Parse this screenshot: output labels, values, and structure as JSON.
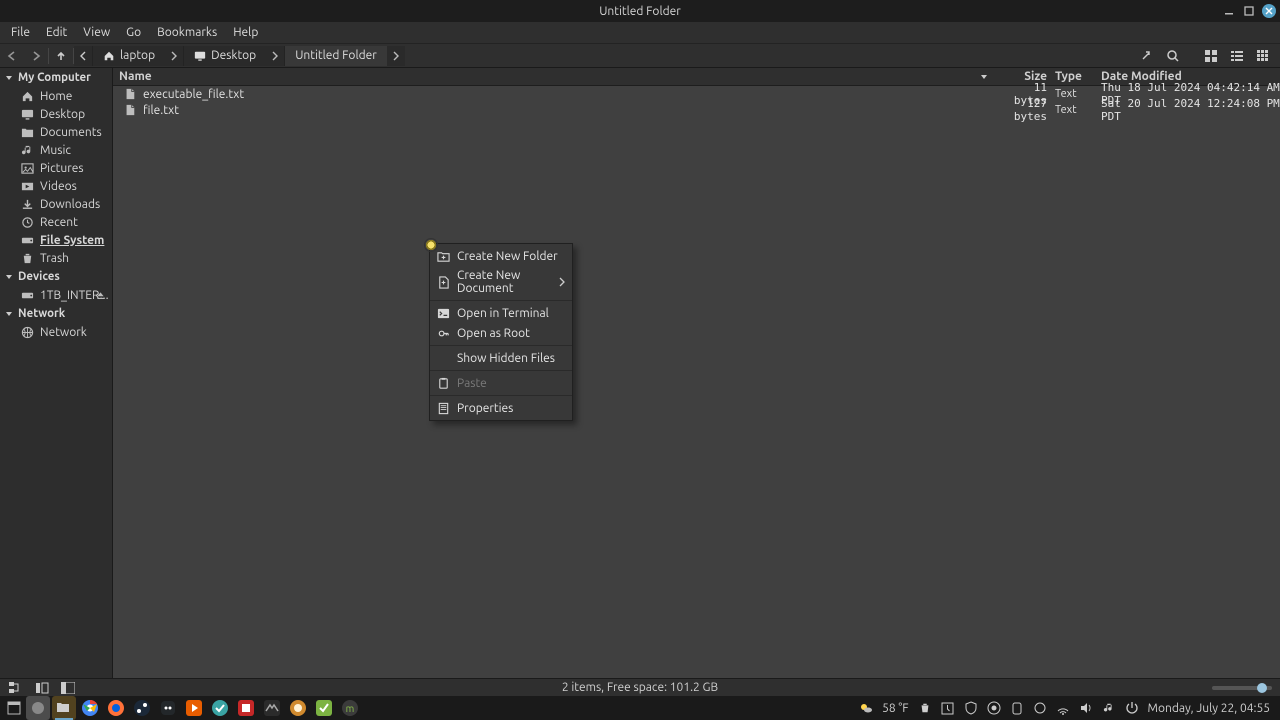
{
  "window": {
    "title": "Untitled Folder"
  },
  "menubar": [
    "File",
    "Edit",
    "View",
    "Go",
    "Bookmarks",
    "Help"
  ],
  "breadcrumbs": [
    {
      "label": "laptop",
      "icon": "home"
    },
    {
      "label": "Desktop",
      "icon": "desktop"
    },
    {
      "label": "Untitled Folder",
      "icon": "",
      "active": true
    }
  ],
  "sidebar": {
    "groups": [
      {
        "title": "My Computer",
        "items": [
          {
            "label": "Home",
            "icon": "home"
          },
          {
            "label": "Desktop",
            "icon": "desktop"
          },
          {
            "label": "Documents",
            "icon": "folder"
          },
          {
            "label": "Music",
            "icon": "music"
          },
          {
            "label": "Pictures",
            "icon": "picture"
          },
          {
            "label": "Videos",
            "icon": "video"
          },
          {
            "label": "Downloads",
            "icon": "download"
          },
          {
            "label": "Recent",
            "icon": "clock"
          },
          {
            "label": "File System",
            "icon": "drive",
            "bold": true
          },
          {
            "label": "Trash",
            "icon": "trash"
          }
        ]
      },
      {
        "title": "Devices",
        "items": [
          {
            "label": "1TB_INTER...",
            "icon": "drive",
            "eject": true
          }
        ]
      },
      {
        "title": "Network",
        "items": [
          {
            "label": "Network",
            "icon": "globe"
          }
        ]
      }
    ]
  },
  "columns": {
    "name": "Name",
    "size": "Size",
    "type": "Type",
    "date": "Date Modified"
  },
  "files": [
    {
      "name": "executable_file.txt",
      "size": "11 bytes",
      "type": "Text",
      "date": "Thu 18 Jul 2024 04:42:14 AM PDT"
    },
    {
      "name": "file.txt",
      "size": "127 bytes",
      "type": "Text",
      "date": "Sat 20 Jul 2024 12:24:08 PM PDT"
    }
  ],
  "context_menu": {
    "items": [
      {
        "label": "Create New Folder",
        "icon": "new-folder"
      },
      {
        "label": "Create New Document",
        "icon": "new-doc",
        "submenu": true
      },
      {
        "sep": true
      },
      {
        "label": "Open in Terminal",
        "icon": "terminal"
      },
      {
        "label": "Open as Root",
        "icon": "key"
      },
      {
        "sep": true
      },
      {
        "label": "Show Hidden Files",
        "icon": ""
      },
      {
        "sep": true
      },
      {
        "label": "Paste",
        "icon": "paste",
        "disabled": true
      },
      {
        "sep": true
      },
      {
        "label": "Properties",
        "icon": "props"
      }
    ]
  },
  "statusbar": {
    "text": "2 items, Free space: 101.2 GB"
  },
  "tray": {
    "weather": "58 °F",
    "clock": "Monday, July 22, 04:55"
  }
}
